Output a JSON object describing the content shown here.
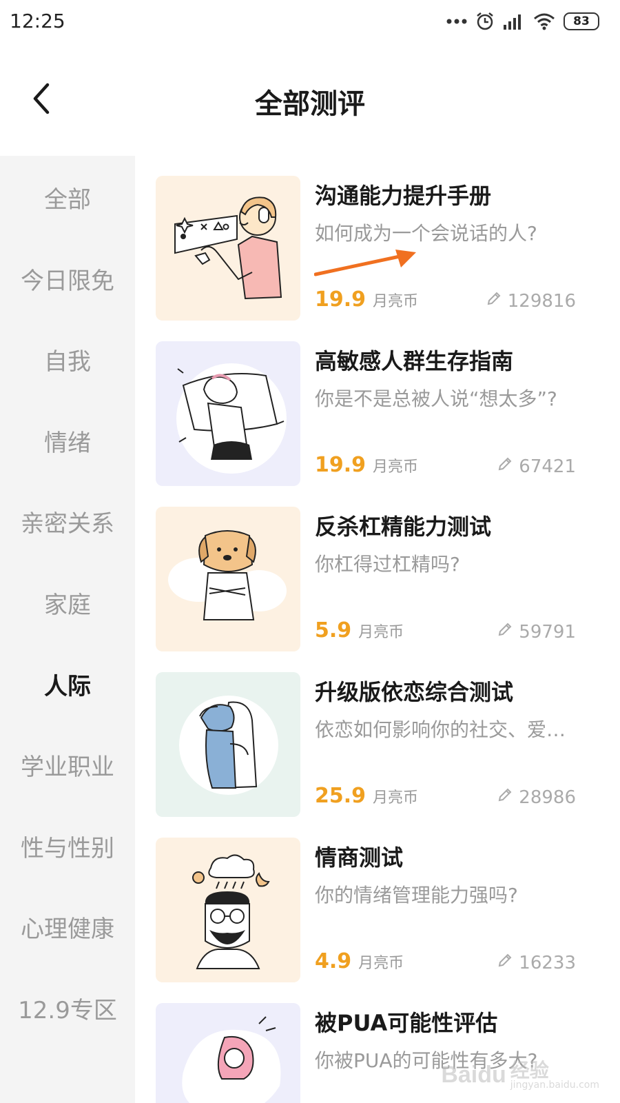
{
  "status_bar": {
    "time": "12:25",
    "battery": "83"
  },
  "nav": {
    "title": "全部测评"
  },
  "sidebar": {
    "items": [
      {
        "label": "全部",
        "active": false
      },
      {
        "label": "今日限免",
        "active": false
      },
      {
        "label": "自我",
        "active": false
      },
      {
        "label": "情绪",
        "active": false
      },
      {
        "label": "亲密关系",
        "active": false
      },
      {
        "label": "家庭",
        "active": false
      },
      {
        "label": "人际",
        "active": true
      },
      {
        "label": "学业职业",
        "active": false
      },
      {
        "label": "性与性别",
        "active": false
      },
      {
        "label": "心理健康",
        "active": false
      },
      {
        "label": "12.9专区",
        "active": false
      }
    ]
  },
  "tests": [
    {
      "title": "沟通能力提升手册",
      "desc": "如何成为一个会说话的人?",
      "price": "19.9",
      "unit": "月亮币",
      "count": "129816",
      "thumb_bg": "#fdf1e2",
      "illustration": "speaking-person-icon"
    },
    {
      "title": "高敏感人群生存指南",
      "desc": "你是不是总被人说“想太多”?",
      "price": "19.9",
      "unit": "月亮币",
      "count": "67421",
      "thumb_bg": "#eeeefb",
      "illustration": "pillow-hug-icon"
    },
    {
      "title": "反杀杠精能力测试",
      "desc": "你杠得过杠精吗?",
      "price": "5.9",
      "unit": "月亮币",
      "count": "59791",
      "thumb_bg": "#fdf1e2",
      "illustration": "dog-head-person-icon"
    },
    {
      "title": "升级版依恋综合测试",
      "desc": "依恋如何影响你的社交、爱情和人生?",
      "price": "25.9",
      "unit": "月亮币",
      "count": "28986",
      "thumb_bg": "#e9f3ef",
      "illustration": "hugging-couple-icon"
    },
    {
      "title": "情商测试",
      "desc": "你的情绪管理能力强吗?",
      "price": "4.9",
      "unit": "月亮币",
      "count": "16233",
      "thumb_bg": "#fdf1e2",
      "illustration": "bearded-man-weather-icon"
    },
    {
      "title": "被PUA可能性评估",
      "desc": "你被PUA的可能性有多大?",
      "price": "",
      "unit": "",
      "count": "",
      "thumb_bg": "#eeeefb",
      "illustration": "pink-hair-girl-icon"
    }
  ],
  "watermark": {
    "logo": "Baidu",
    "cn": "经验",
    "url": "jingyan.baidu.com"
  },
  "colors": {
    "price": "#f0a020",
    "arrow": "#f07020",
    "sidebar_bg": "#f4f4f4",
    "muted_text": "#9a9a9a"
  }
}
